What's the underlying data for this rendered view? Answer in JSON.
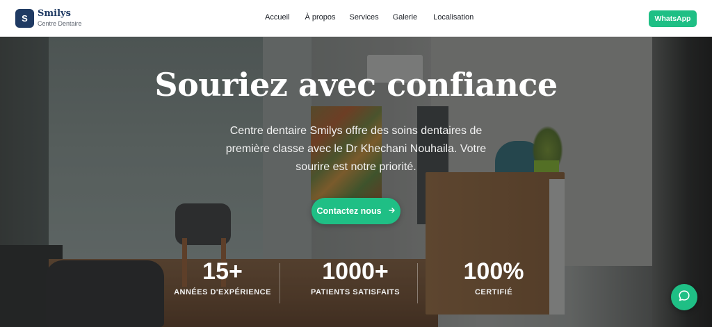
{
  "header": {
    "logo_letter": "S",
    "brand_name": "Smilys",
    "brand_subtitle": "Centre Dentaire",
    "nav": [
      "Accueil",
      "À propos",
      "Services",
      "Galerie",
      "Localisation"
    ],
    "whatsapp_label": "WhatsApp"
  },
  "hero": {
    "title": "Souriez avec confiance",
    "subtitle": "Centre dentaire Smilys offre des soins dentaires de première classe avec le Dr Khechani Nouhaila. Votre sourire est notre priorité.",
    "cta_label": "Contactez nous",
    "stats": [
      {
        "value": "15+",
        "label": "ANNÉES D'EXPÉRIENCE"
      },
      {
        "value": "1000+",
        "label": "PATIENTS SATISFAITS"
      },
      {
        "value": "100%",
        "label": "CERTIFIÉ"
      }
    ]
  },
  "colors": {
    "accent": "#1fbf85",
    "brand": "#1f3a63"
  },
  "icons": {
    "cta_icon": "arrow-right-icon",
    "chat_icon": "chat-bubble-icon"
  }
}
